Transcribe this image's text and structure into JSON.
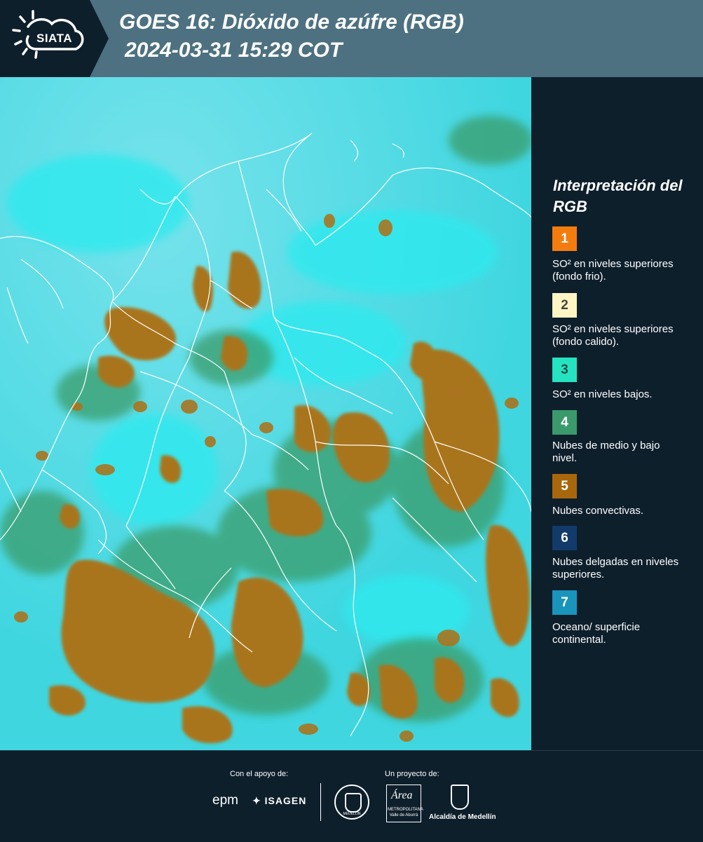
{
  "header": {
    "logo_text": "SIATA",
    "title": "GOES 16: Dióxido de azúfre (RGB)",
    "datetime": "2024-03-31 15:29 COT"
  },
  "legend": {
    "title": "Interpretación del RGB",
    "items": [
      {
        "num": "1",
        "label": "SO² en niveles superiores (fondo frio).",
        "color": "#f47c0e",
        "text_color": "#ffffff"
      },
      {
        "num": "2",
        "label": "SO² en niveles superiores (fondo calido).",
        "color": "#fff6c4",
        "text_color": "#444444"
      },
      {
        "num": "3",
        "label": "SO² en niveles bajos.",
        "color": "#25e3c0",
        "text_color": "#1e4f4a"
      },
      {
        "num": "4",
        "label": "Nubes de medio y bajo nivel.",
        "color": "#3a9a6c",
        "text_color": "#ffffff"
      },
      {
        "num": "5",
        "label": "Nubes convectivas.",
        "color": "#a8670c",
        "text_color": "#ffffff"
      },
      {
        "num": "6",
        "label": "Nubes delgadas en niveles superiores.",
        "color": "#123a6b",
        "text_color": "#ffffff"
      },
      {
        "num": "7",
        "label": "Oceano/ superficie continental.",
        "color": "#1994bb",
        "text_color": "#ffffff"
      }
    ]
  },
  "footer": {
    "support_label": "Con el apoyo de:",
    "project_label": "Un proyecto de:",
    "sponsor_epm": "epm",
    "sponsor_isagen": "ISAGEN",
    "partner_area": "Área",
    "partner_area_sub": "METROPOLITANA",
    "partner_area_sub2": "Valle de Aburrá",
    "partner_alcaldia": "Alcaldía de Medellín",
    "partner_seal": "MEDELLÍN"
  },
  "map": {
    "background_color": "#47d7df",
    "ocean_color": "#36e6ec",
    "convective_color": "#b07b22",
    "border_color": "#ffffff"
  }
}
